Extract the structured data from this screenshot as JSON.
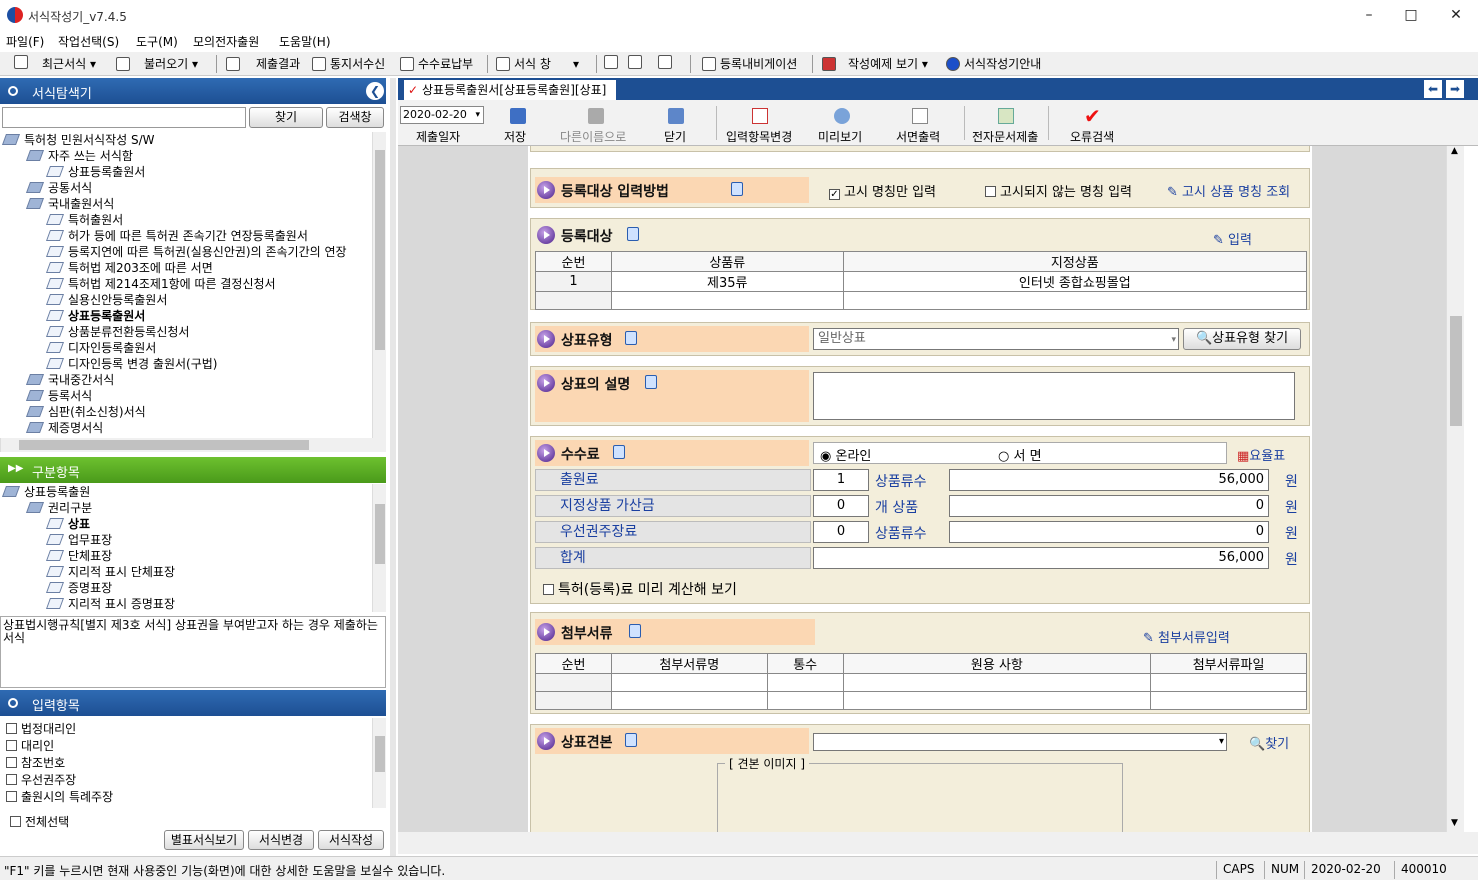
{
  "app": {
    "title": "서식작성기_v7.4.5"
  },
  "menu": [
    "파일(F)",
    "작업선택(S)",
    "도구(M)",
    "모의전자출원",
    "도움말(H)"
  ],
  "toolbar": {
    "recent": "최근서식",
    "load": "불러오기",
    "submit_result": "제출결과",
    "notice_receive": "통지서수신",
    "fee_pay": "수수료납부",
    "form_window": "서식 창",
    "reg_nav": "등록내비게이션",
    "example_view": "작성예제 보기",
    "guide": "서식작성기안내"
  },
  "explorer": {
    "title": "서식탐색기",
    "search_value": "",
    "find_btn": "찾기",
    "search_window_btn": "검색창",
    "tree": [
      {
        "label": "특허청 민원서식작성 S/W",
        "level": 0
      },
      {
        "label": "자주 쓰는 서식함",
        "level": 1
      },
      {
        "label": "상표등록출원서",
        "level": 2
      },
      {
        "label": "공통서식",
        "level": 1
      },
      {
        "label": "국내출원서식",
        "level": 1
      },
      {
        "label": "특허출원서",
        "level": 2
      },
      {
        "label": "허가 등에 따른 특허권 존속기간 연장등록출원서",
        "level": 2
      },
      {
        "label": "등록지연에 따른 특허권(실용신안권)의 존속기간의 연장",
        "level": 2
      },
      {
        "label": "특허법 제203조에 따른 서면",
        "level": 2
      },
      {
        "label": "특허법 제214조제1항에 따른 결정신청서",
        "level": 2
      },
      {
        "label": "실용신안등록출원서",
        "level": 2
      },
      {
        "label": "상표등록출원서",
        "level": 2,
        "bold": true
      },
      {
        "label": "상품분류전환등록신청서",
        "level": 2
      },
      {
        "label": "디자인등록출원서",
        "level": 2
      },
      {
        "label": "디자인등록 변경 출원서(구법)",
        "level": 2
      },
      {
        "label": "국내중간서식",
        "level": 1
      },
      {
        "label": "등록서식",
        "level": 1
      },
      {
        "label": "심판(취소신청)서식",
        "level": 1
      },
      {
        "label": "제증명서식",
        "level": 1
      }
    ]
  },
  "category": {
    "title": "구분항목",
    "tree": [
      {
        "label": "상표등록출원",
        "level": 0
      },
      {
        "label": "권리구분",
        "level": 1
      },
      {
        "label": "상표",
        "level": 2,
        "bold": true
      },
      {
        "label": "업무표장",
        "level": 2
      },
      {
        "label": "단체표장",
        "level": 2
      },
      {
        "label": "지리적 표시 단체표장",
        "level": 2
      },
      {
        "label": "증명표장",
        "level": 2
      },
      {
        "label": "지리적 표시 증명표장",
        "level": 2
      }
    ],
    "description": "상표법시행규칙[별지 제3호 서식] 상표권을 부여받고자 하는 경우 제출하는 서식"
  },
  "input_items": {
    "title": "입력항목",
    "items": [
      "법정대리인",
      "대리인",
      "참조번호",
      "우선권주장",
      "출원시의 특례주장"
    ],
    "select_all": "전체선택",
    "btn_appendix": "별표서식보기",
    "btn_change": "서식변경",
    "btn_write": "서식작성"
  },
  "doc": {
    "tab_label": "상표등록출원서[상표등록출원][상표]",
    "toolbar": {
      "date": "2020-02-20",
      "submit_date": "제출일자",
      "save": "저장",
      "save_as": "다른이름으로",
      "close": "닫기",
      "change_items": "입력항목변경",
      "preview": "미리보기",
      "print": "서면출력",
      "e_submit": "전자문서제출",
      "error_check": "오류검색"
    }
  },
  "form": {
    "method": {
      "title": "등록대상 입력방법",
      "opt1": "고시 명칭만 입력",
      "opt2": "고시되지 않는 명칭 입력",
      "lookup": "고시 상품 명칭 조회"
    },
    "target": {
      "title": "등록대상",
      "input": "입력",
      "headers": [
        "순번",
        "상품류",
        "지정상품"
      ],
      "rows": [
        [
          "1",
          "제35류",
          "인터넷 종합쇼핑몰업"
        ],
        [
          "",
          "",
          ""
        ]
      ]
    },
    "type": {
      "title": "상표유형",
      "value": "일반상표",
      "find": "상표유형 찾기"
    },
    "desc": {
      "title": "상표의 설명",
      "value": ""
    },
    "fee": {
      "title": "수수료",
      "online": "온라인",
      "paper": "서 면",
      "rate_table": "요율표",
      "rows": [
        {
          "label": "출원료",
          "count": "1",
          "count_label": "상품류수",
          "amount": "56,000",
          "unit": "원"
        },
        {
          "label": "지정상품 가산금",
          "count": "0",
          "count_label": "개 상품",
          "amount": "0",
          "unit": "원"
        },
        {
          "label": "우선권주장료",
          "count": "0",
          "count_label": "상품류수",
          "amount": "0",
          "unit": "원"
        }
      ],
      "total_label": "합계",
      "total": "56,000",
      "total_unit": "원",
      "precalc": "특허(등록)료 미리 계산해 보기"
    },
    "attach": {
      "title": "첨부서류",
      "input": "첨부서류입력",
      "headers": [
        "순번",
        "첨부서류명",
        "통수",
        "원용 사항",
        "첨부서류파일"
      ]
    },
    "sample": {
      "title": "상표견본",
      "find": "찾기",
      "image_label": "[ 견본 이미지 ]"
    }
  },
  "status": {
    "help": "\"F1\" 키를 누르시면 현재 사용중인 기능(화면)에 대한 상세한 도움말을 보실수 있습니다.",
    "caps": "CAPS",
    "num": "NUM",
    "date": "2020-02-20",
    "code": "400010"
  }
}
